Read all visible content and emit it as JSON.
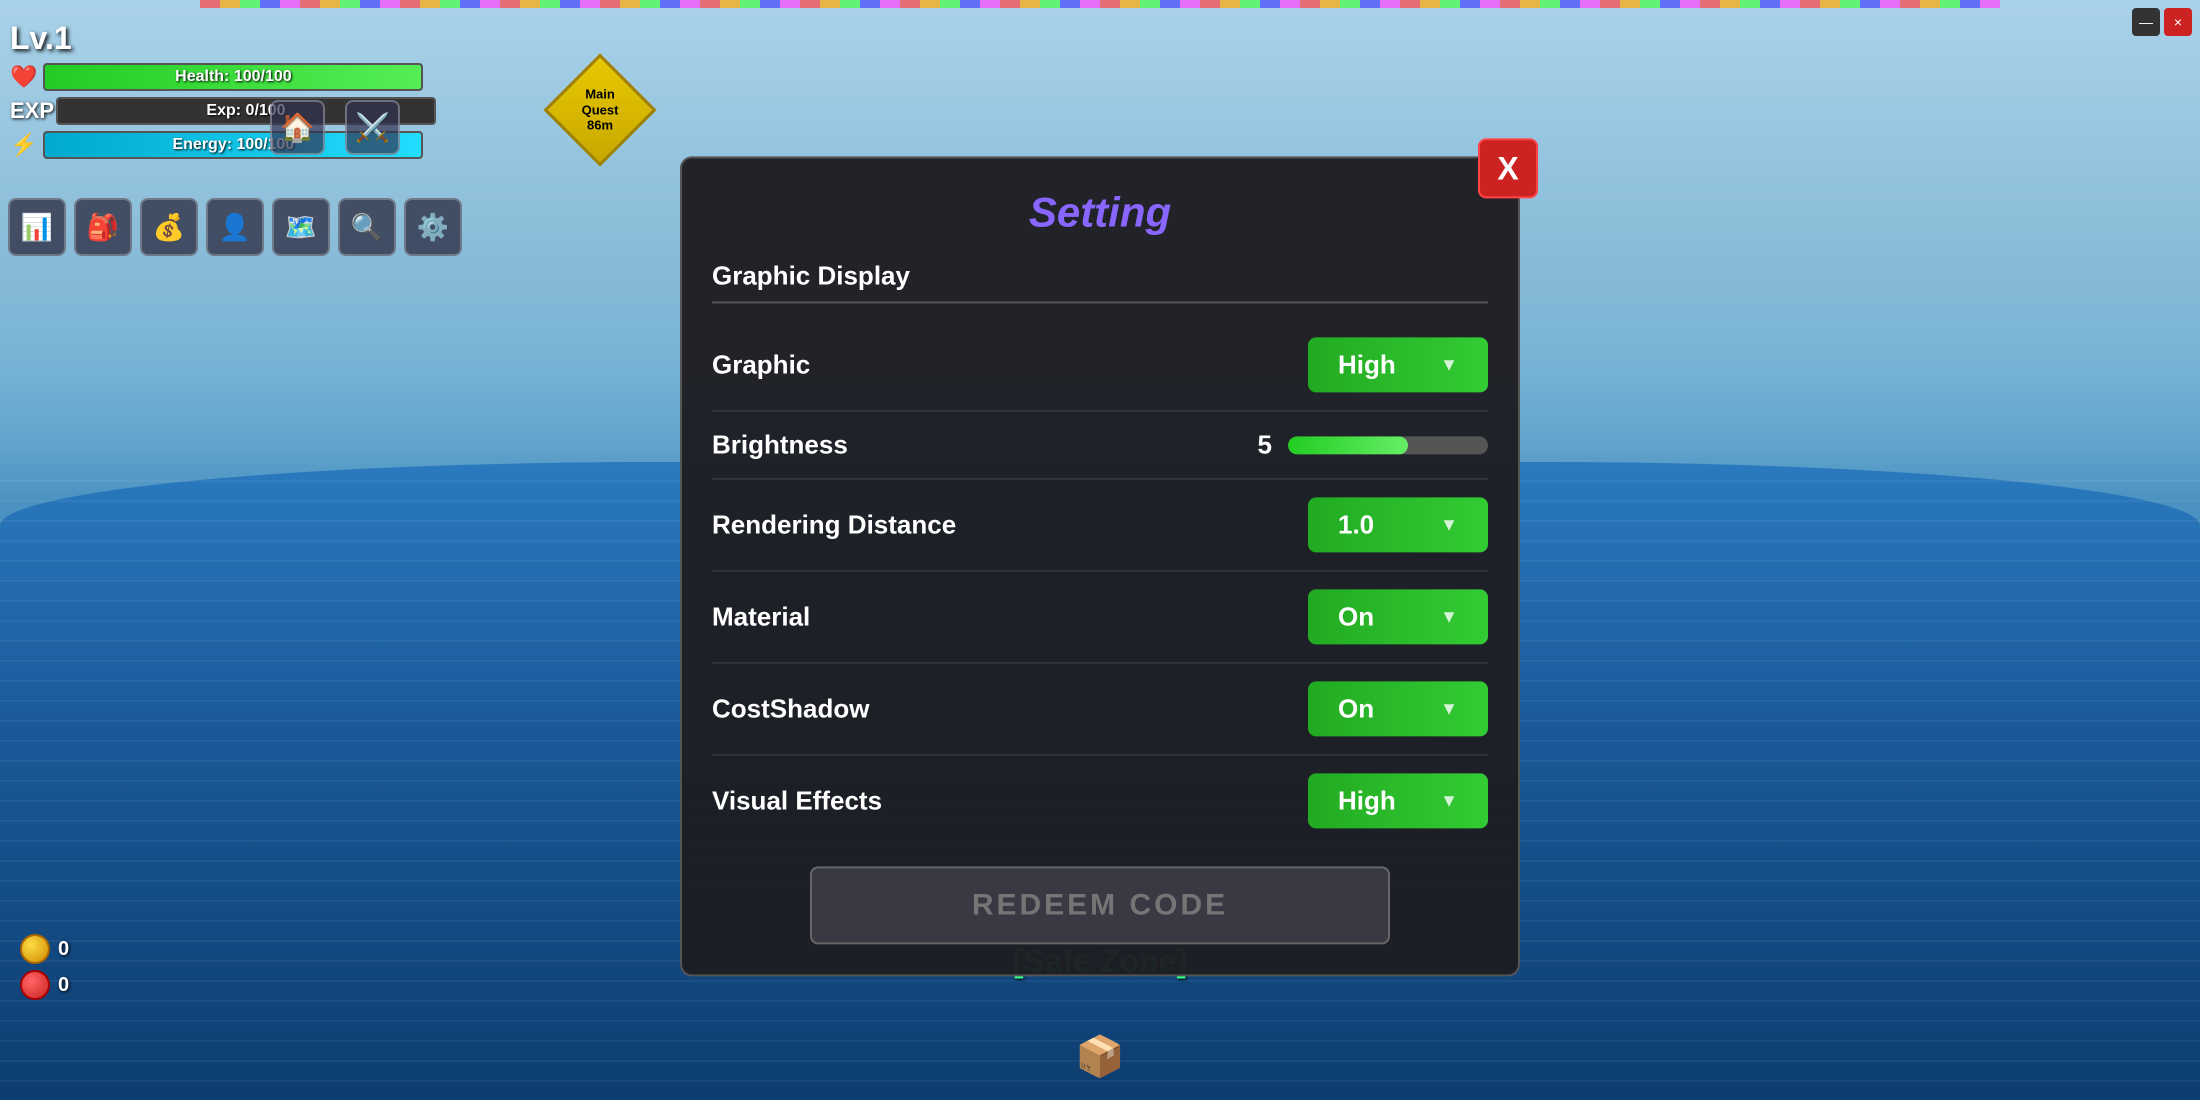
{
  "game": {
    "title": "Setting",
    "player": {
      "level": "Lv.1",
      "health": "Health: 100/100",
      "health_pct": 100,
      "exp": "Exp: 0/100",
      "exp_pct": 0,
      "energy": "Energy: 100/100",
      "energy_pct": 100
    },
    "main_quest": {
      "label": "Main Quest",
      "distance": "86m"
    },
    "safe_zone": "[Safe Zone]",
    "currency": {
      "coins": "0",
      "gems": "0"
    }
  },
  "settings": {
    "section_title": "Graphic Display",
    "rows": [
      {
        "label": "Graphic",
        "value": "High"
      },
      {
        "label": "Brightness",
        "value": "5",
        "type": "slider",
        "pct": 60
      },
      {
        "label": "Rendering Distance",
        "value": "1.0"
      },
      {
        "label": "Material",
        "value": "On"
      },
      {
        "label": "CostShadow",
        "value": "On"
      },
      {
        "label": "Visual Effects",
        "value": "High"
      }
    ],
    "redeem_placeholder": "REDEEM CODE"
  },
  "ui": {
    "close_btn": "X",
    "nav_icons": [
      "🏠",
      "⚔️"
    ],
    "toolbar_icons": [
      "📊",
      "🎒",
      "💰",
      "👤",
      "🗺️",
      "🔍",
      "⚙️"
    ],
    "window_close": "×",
    "window_min": "—",
    "chest_icon": "📦"
  }
}
